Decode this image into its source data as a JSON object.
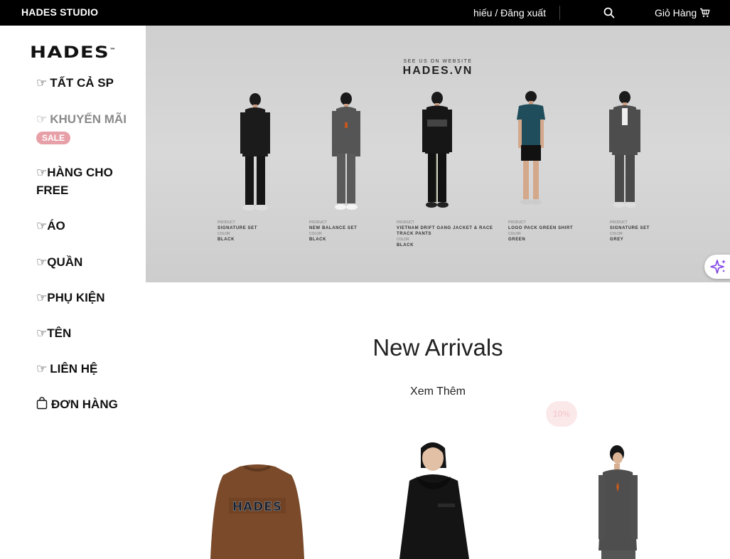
{
  "topbar": {
    "brand": "HADES STUDIO",
    "auth": "hiếu / Đăng xuất",
    "search_icon": "search-icon",
    "cart_label": "Giỏ Hàng",
    "cart_icon": "cart-icon"
  },
  "sidebar": {
    "logo": "HADES",
    "logo_mark": "™",
    "hand_glyph": "☞",
    "items": [
      {
        "label": "TẤT CẢ SP"
      },
      {
        "label": "KHUYẾN MÃI",
        "badge": "SALE"
      },
      {
        "label": "HÀNG CHO FREE"
      },
      {
        "label": "ÁO"
      },
      {
        "label": "QUẦN"
      },
      {
        "label": "PHỤ KIỆN"
      },
      {
        "label": "TÊN"
      },
      {
        "label": "LIÊN HỆ"
      },
      {
        "label": "ĐƠN HÀNG",
        "icon": "shopping-bag-icon"
      }
    ]
  },
  "banner": {
    "small_text": "SEE US ON WEBSITE",
    "title": "HADES.VN",
    "products": [
      {
        "product_label": "PRODUCT",
        "product": "SIGNATURE SET",
        "color_label": "COLOR",
        "color": "BLACK"
      },
      {
        "product_label": "PRODUCT",
        "product": "NEW BALANCE SET",
        "color_label": "COLOR",
        "color": "BLACK"
      },
      {
        "product_label": "PRODUCT",
        "product": "VIETNAM DRIFT GANG JACKET & RACE TRACK PANTS",
        "color_label": "COLOR",
        "color": "BLACK"
      },
      {
        "product_label": "PRODUCT",
        "product": "LOGO PACK GREEN SHIRT",
        "color_label": "COLOR",
        "color": "GREEN"
      },
      {
        "product_label": "PRODUCT",
        "product": "SIGNATURE SET",
        "color_label": "COLOR",
        "color": "GREY"
      }
    ]
  },
  "assistant": {
    "icon": "sparkle-icon"
  },
  "main": {
    "section_title": "New Arrivals",
    "see_more": "Xem Thêm",
    "discount_badge": "10%",
    "product_cards": [
      {
        "print": "HADES"
      },
      {},
      {}
    ]
  }
}
